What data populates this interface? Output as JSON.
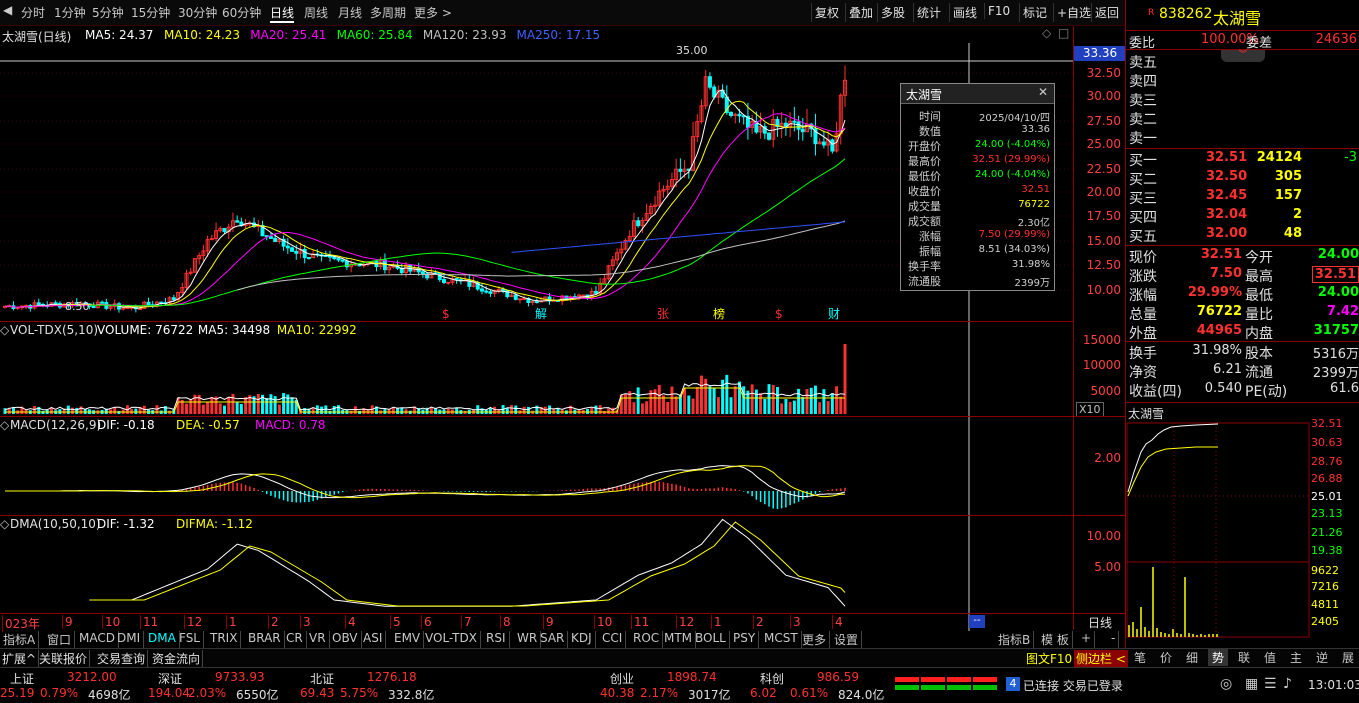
{
  "toolbar": {
    "periods": [
      "分时",
      "1分钟",
      "5分钟",
      "15分钟",
      "30分钟",
      "60分钟",
      "日线",
      "周线",
      "月线",
      "多周期",
      "更多 >"
    ],
    "active": "日线",
    "right": [
      "复权",
      "叠加",
      "多股",
      "统计",
      "画线",
      "F10",
      "标记",
      "+自选",
      "返回"
    ]
  },
  "main": {
    "title": "太湖雪(日线)",
    "ma": [
      {
        "label": "MA5: 24.37",
        "color": "#ffffff"
      },
      {
        "label": "MA10: 24.23",
        "color": "#ffff00"
      },
      {
        "label": "MA20: 25.41",
        "color": "#ff00ff"
      },
      {
        "label": "MA60: 25.84",
        "color": "#00ff00"
      },
      {
        "label": "MA120: 23.93",
        "color": "#c0c0c0"
      },
      {
        "label": "MA250: 17.15",
        "color": "#4060ff"
      }
    ],
    "yticks": [
      "32.50",
      "30.00",
      "27.50",
      "25.00",
      "22.50",
      "20.00",
      "17.50",
      "15.00",
      "12.50",
      "10.00"
    ],
    "cur_price": "33.36",
    "high_label": "35.00",
    "low_label": "8.50",
    "markers": [
      {
        "text": "$",
        "color": "#ff3030"
      },
      {
        "text": "解",
        "color": "#00ffff"
      },
      {
        "text": "张",
        "color": "#ff3030"
      },
      {
        "text": "榜",
        "color": "#ffff00"
      },
      {
        "text": "$",
        "color": "#ff3030"
      },
      {
        "text": "财",
        "color": "#00ffff"
      }
    ]
  },
  "tooltip": {
    "title": "太湖雪",
    "rows": [
      {
        "label": "时间",
        "value": "2025/04/10/四",
        "color": "#d0d0d0"
      },
      {
        "label": "数值",
        "value": "33.36",
        "color": "#d0d0d0"
      },
      {
        "label": "开盘价",
        "value": "24.00 (-4.04%)",
        "color": "#00ff00"
      },
      {
        "label": "最高价",
        "value": "32.51 (29.99%)",
        "color": "#ff3030"
      },
      {
        "label": "最低价",
        "value": "24.00 (-4.04%)",
        "color": "#00ff00"
      },
      {
        "label": "收盘价",
        "value": "32.51",
        "color": "#ff3030"
      },
      {
        "label": "成交量",
        "value": "76722",
        "color": "#ffff00"
      },
      {
        "label": "成交额",
        "value": "2.30亿",
        "color": "#d0d0d0"
      },
      {
        "label": "涨幅",
        "value": "7.50 (29.99%)",
        "color": "#ff3030"
      },
      {
        "label": "振幅",
        "value": "8.51 (34.03%)",
        "color": "#d0d0d0"
      },
      {
        "label": "换手率",
        "value": "31.98%",
        "color": "#d0d0d0"
      },
      {
        "label": "流通股",
        "value": "2399万",
        "color": "#d0d0d0"
      }
    ]
  },
  "vol": {
    "title": "VOL-TDX(5,10)",
    "items": [
      {
        "label": "VOLUME: 76722",
        "color": "#ffffff"
      },
      {
        "label": "MA5: 34498",
        "color": "#ffffff"
      },
      {
        "label": "MA10: 22992",
        "color": "#ffff00"
      }
    ],
    "yticks": [
      "15000",
      "10000",
      "5000"
    ],
    "unit": "X10"
  },
  "macd": {
    "title": "MACD(12,26,9)",
    "items": [
      {
        "label": "DIF: -0.18",
        "color": "#ffffff"
      },
      {
        "label": "DEA: -0.57",
        "color": "#ffff00"
      },
      {
        "label": "MACD: 0.78",
        "color": "#ff00ff"
      }
    ],
    "yticks": [
      "2.00"
    ]
  },
  "dma": {
    "title": "DMA(10,50,10)",
    "items": [
      {
        "label": "DIF: -1.32",
        "color": "#ffffff"
      },
      {
        "label": "DIFMA: -1.12",
        "color": "#ffff00"
      }
    ],
    "yticks": [
      "10.00",
      "5.00"
    ]
  },
  "xaxis": {
    "labels": [
      "023年",
      "9",
      "10",
      "11",
      "12",
      "1",
      "2",
      "3",
      "4",
      "5",
      "6",
      "7",
      "8",
      "9",
      "10",
      "11",
      "12",
      "1",
      "2",
      "3",
      "4"
    ],
    "period_label": "日线"
  },
  "indicators": [
    "指标A",
    "窗口",
    "MACD",
    "DMI",
    "DMA",
    "FSL",
    "TRIX",
    "BRAR",
    "CR",
    "VR",
    "OBV",
    "ASI",
    "EMV",
    "VOL-TDX",
    "RSI",
    "WR",
    "SAR",
    "KDJ",
    "CCI",
    "ROC",
    "MTM",
    "BOLL",
    "PSY",
    "MCST",
    "更多",
    "设置"
  ],
  "active_indicator": "DMA",
  "indicator_right": [
    "指标B",
    "模 板",
    "+",
    "-"
  ],
  "sub_tabs": [
    "扩展^",
    "关联报价",
    "交易查询",
    "资金流向"
  ],
  "sub_right": [
    "图文F10",
    "侧边栏 <"
  ],
  "quote": {
    "code": "838262",
    "name": "太湖雪",
    "badge": "R",
    "weibi_label": "委比",
    "weibi": "100.00%",
    "weicha_label": "委差",
    "weicha": "24636",
    "sell": [
      {
        "label": "卖五",
        "price": "",
        "vol": ""
      },
      {
        "label": "卖四",
        "price": "",
        "vol": ""
      },
      {
        "label": "卖三",
        "price": "",
        "vol": ""
      },
      {
        "label": "卖二",
        "price": "",
        "vol": ""
      },
      {
        "label": "卖一",
        "price": "",
        "vol": ""
      }
    ],
    "buy": [
      {
        "label": "买一",
        "price": "32.51",
        "vol": "24124",
        "chg": "-3"
      },
      {
        "label": "买二",
        "price": "32.50",
        "vol": "305",
        "chg": ""
      },
      {
        "label": "买三",
        "price": "32.45",
        "vol": "157",
        "chg": ""
      },
      {
        "label": "买四",
        "price": "32.04",
        "vol": "2",
        "chg": ""
      },
      {
        "label": "买五",
        "price": "32.00",
        "vol": "48",
        "chg": ""
      }
    ],
    "stats": [
      {
        "l1": "现价",
        "v1": "32.51",
        "c1": "#ff3030",
        "l2": "今开",
        "v2": "24.00",
        "c2": "#00ff00"
      },
      {
        "l1": "涨跌",
        "v1": "7.50",
        "c1": "#ff3030",
        "l2": "最高",
        "v2": "32.51",
        "c2": "#ff3030"
      },
      {
        "l1": "涨幅",
        "v1": "29.99%",
        "c1": "#ff3030",
        "l2": "最低",
        "v2": "24.00",
        "c2": "#00ff00"
      },
      {
        "l1": "总量",
        "v1": "76722",
        "c1": "#ffff00",
        "l2": "量比",
        "v2": "7.42",
        "c2": "#ff00ff"
      },
      {
        "l1": "外盘",
        "v1": "44965",
        "c1": "#ff3030",
        "l2": "内盘",
        "v2": "31757",
        "c2": "#00ff00"
      }
    ],
    "stats2": [
      {
        "l1": "换手",
        "v1": "31.98%",
        "l2": "股本",
        "v2": "5316万"
      },
      {
        "l1": "净资",
        "v1": "6.21",
        "l2": "流通",
        "v2": "2399万"
      },
      {
        "l1": "收益(四)",
        "v1": "0.540",
        "l2": "PE(动)",
        "v2": "61.6"
      }
    ]
  },
  "mini": {
    "title": "太湖雪",
    "yticks": [
      {
        "v": "32.51",
        "c": "#ff3030"
      },
      {
        "v": "30.63",
        "c": "#ff3030"
      },
      {
        "v": "28.76",
        "c": "#ff3030"
      },
      {
        "v": "26.88",
        "c": "#ff3030"
      },
      {
        "v": "25.01",
        "c": "#ffffff"
      },
      {
        "v": "23.13",
        "c": "#00ff00"
      },
      {
        "v": "21.26",
        "c": "#00ff00"
      },
      {
        "v": "19.38",
        "c": "#00ff00"
      },
      {
        "v": "9622",
        "c": "#ffff00"
      },
      {
        "v": "7216",
        "c": "#ffff00"
      },
      {
        "v": "4811",
        "c": "#ffff00"
      },
      {
        "v": "2405",
        "c": "#ffff00"
      }
    ]
  },
  "mini_tabs": [
    "笔",
    "价",
    "细",
    "势",
    "联",
    "值",
    "主",
    "逆",
    "展"
  ],
  "mini_active": "势",
  "status": {
    "indices": [
      {
        "name": "上证",
        "val": "3212.00",
        "chg": "25.19",
        "pct": "0.79%",
        "amt": "4698亿"
      },
      {
        "name": "深证",
        "val": "9733.93",
        "chg": "194.04",
        "pct": "2.03%",
        "amt": "6550亿"
      },
      {
        "name": "北证",
        "val": "1276.18",
        "chg": "69.43",
        "pct": "5.75%",
        "amt": "332.8亿"
      },
      {
        "name": "创业",
        "val": "1898.74",
        "chg": "40.38",
        "pct": "2.17%",
        "amt": "3017亿"
      },
      {
        "name": "科创",
        "val": "986.59",
        "chg": "6.02",
        "pct": "0.61%",
        "amt": "824.0亿"
      }
    ],
    "conn_num": "4",
    "conn": "已连接 交易已登录",
    "time": "13:01:03"
  }
}
